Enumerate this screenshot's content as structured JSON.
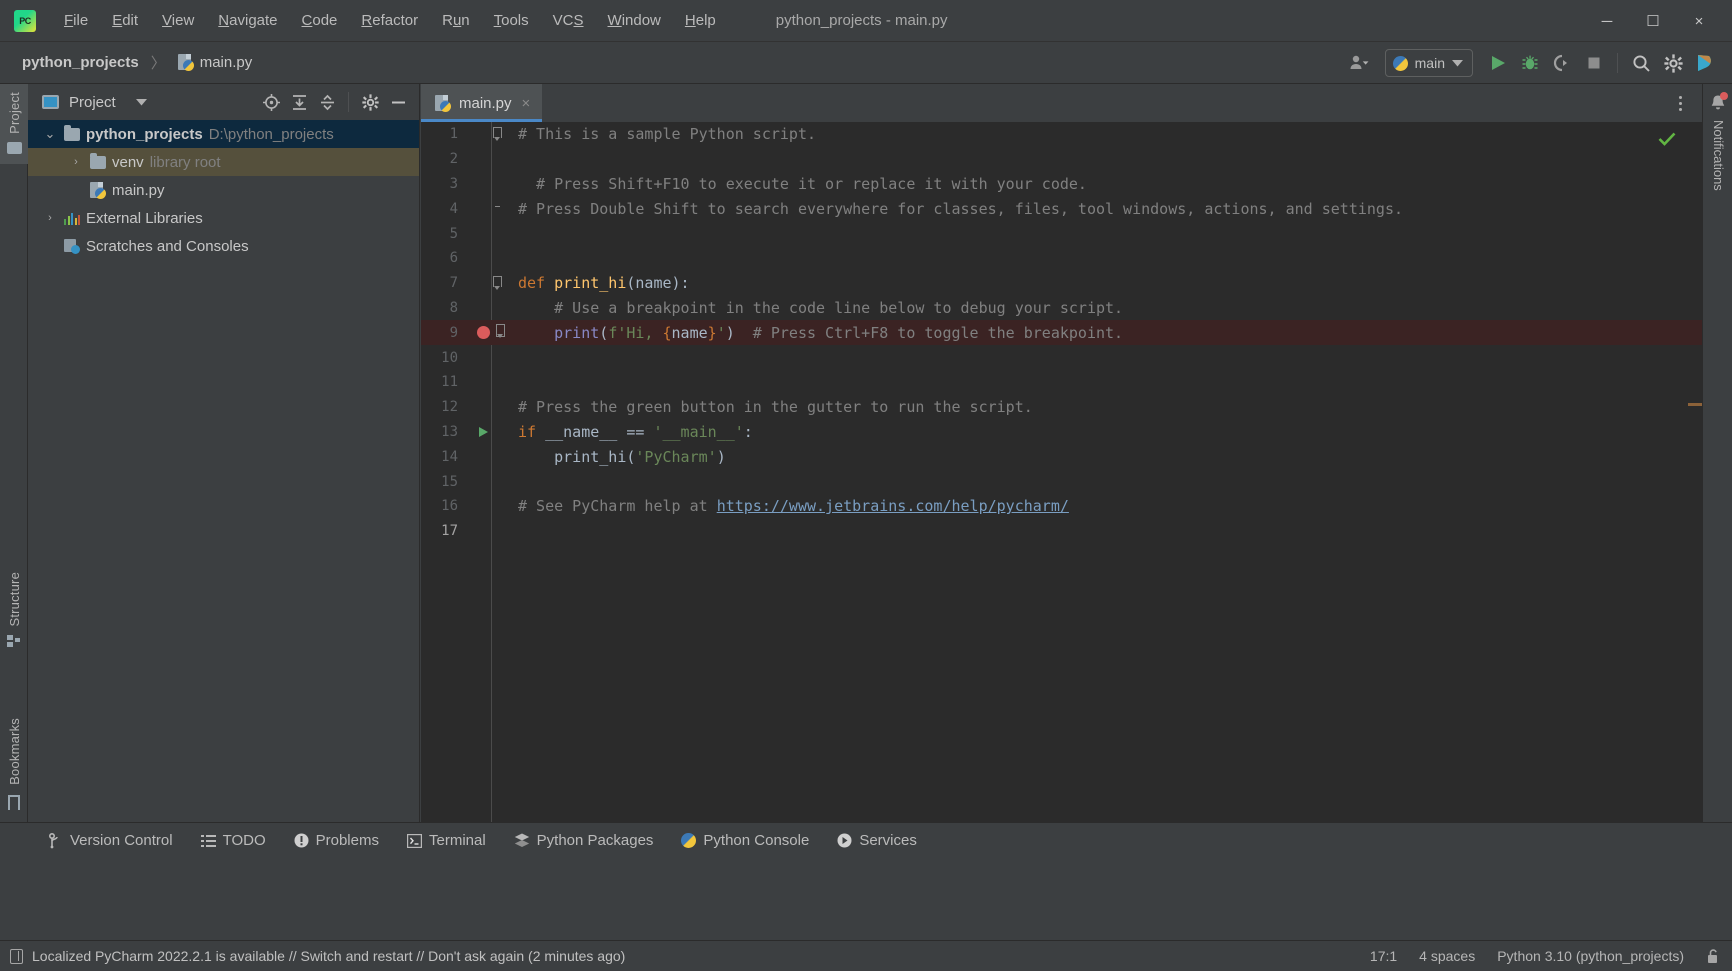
{
  "window": {
    "title": "python_projects - main.py",
    "app_icon": "pycharm-logo-icon",
    "minimize": "─",
    "maximize": "☐",
    "close": "×"
  },
  "menubar": {
    "items": [
      {
        "label": "File",
        "mnemonic": "F"
      },
      {
        "label": "Edit",
        "mnemonic": "E"
      },
      {
        "label": "View",
        "mnemonic": "V"
      },
      {
        "label": "Navigate",
        "mnemonic": "N"
      },
      {
        "label": "Code",
        "mnemonic": "C"
      },
      {
        "label": "Refactor",
        "mnemonic": "R"
      },
      {
        "label": "Run",
        "mnemonic": "u"
      },
      {
        "label": "Tools",
        "mnemonic": "T"
      },
      {
        "label": "VCS",
        "mnemonic": "S"
      },
      {
        "label": "Window",
        "mnemonic": "W"
      },
      {
        "label": "Help",
        "mnemonic": "H"
      }
    ]
  },
  "navbar": {
    "breadcrumbs": [
      {
        "label": "python_projects",
        "icon": "none"
      },
      {
        "label": "main.py",
        "icon": "python-file-icon"
      }
    ],
    "separator": "〉"
  },
  "toolbar": {
    "account_label": "account-icon",
    "run_config": {
      "label": "main",
      "icon": "python-icon",
      "chevron": "▼"
    },
    "buttons": [
      {
        "name": "run-button",
        "icon": "run-triangle-icon"
      },
      {
        "name": "debug-button",
        "icon": "bug-icon"
      },
      {
        "name": "run-with-coverage-button",
        "icon": "coverage-icon"
      },
      {
        "name": "stop-button",
        "icon": "stop-square-icon"
      },
      {
        "name": "search-everywhere-button",
        "icon": "search-icon"
      },
      {
        "name": "settings-button",
        "icon": "gear-icon"
      },
      {
        "name": "ai-assistant-button",
        "icon": "jetbrains-logo-icon"
      }
    ]
  },
  "left_rail": {
    "items": [
      {
        "label": "Project",
        "icon": "project-folder-icon",
        "active": true
      },
      {
        "label": "Structure",
        "icon": "structure-icon",
        "active": false
      },
      {
        "label": "Bookmarks",
        "icon": "bookmark-icon",
        "active": false
      }
    ]
  },
  "project_panel": {
    "title": "Project",
    "title_icon": "project-window-icon",
    "chevron": "▼",
    "header_buttons": [
      {
        "name": "select-opened-file-button",
        "icon": "crosshair-icon"
      },
      {
        "name": "expand-all-button",
        "icon": "expand-all-icon"
      },
      {
        "name": "collapse-all-button",
        "icon": "collapse-all-icon"
      },
      {
        "name": "options-button",
        "icon": "gear-icon"
      },
      {
        "name": "hide-button",
        "icon": "minimize-icon"
      }
    ],
    "tree": [
      {
        "label": "python_projects",
        "suffix": "D:\\python_projects",
        "icon": "folder-icon",
        "indent": 0,
        "arrow": "⌄",
        "expanded": true,
        "state": "selected",
        "bold": true
      },
      {
        "label": "venv",
        "suffix": "library root",
        "icon": "folder-icon",
        "indent": 1,
        "arrow": "›",
        "expanded": false,
        "state": "hover",
        "bold": false
      },
      {
        "label": "main.py",
        "suffix": "",
        "icon": "python-file-icon",
        "indent": 1,
        "arrow": "",
        "expanded": false,
        "state": "normal",
        "bold": false
      },
      {
        "label": "External Libraries",
        "suffix": "",
        "icon": "external-libraries-icon",
        "indent": 0,
        "arrow": "›",
        "expanded": false,
        "state": "normal",
        "bold": false
      },
      {
        "label": "Scratches and Consoles",
        "suffix": "",
        "icon": "scratches-icon",
        "indent": 0,
        "arrow": "",
        "expanded": false,
        "state": "normal",
        "bold": false
      }
    ]
  },
  "editor": {
    "tabs": [
      {
        "label": "main.py",
        "icon": "python-file-icon",
        "active": true,
        "close": "×"
      }
    ],
    "more_button": "editor-options-icon",
    "inspection_status": "ok-checkmark",
    "lines": [
      {
        "n": "1",
        "gutter": "fold-start",
        "tokens": [
          {
            "t": "# This is a sample Python script.",
            "c": "k-comment"
          }
        ]
      },
      {
        "n": "2",
        "gutter": "",
        "tokens": []
      },
      {
        "n": "3",
        "gutter": "",
        "tokens": [
          {
            "t": "  # Press Shift+F10 to execute it or replace it with your code.",
            "c": "k-comment"
          }
        ]
      },
      {
        "n": "4",
        "gutter": "fold-end",
        "tokens": [
          {
            "t": "# Press Double Shift to search everywhere for classes, files, tool windows, actions, and settings.",
            "c": "k-comment"
          }
        ]
      },
      {
        "n": "5",
        "gutter": "",
        "tokens": []
      },
      {
        "n": "6",
        "gutter": "",
        "tokens": []
      },
      {
        "n": "7",
        "gutter": "fold-start",
        "tokens": [
          {
            "t": "def ",
            "c": "k-kw"
          },
          {
            "t": "print_hi",
            "c": "k-fn"
          },
          {
            "t": "(name):",
            "c": "k-name"
          }
        ]
      },
      {
        "n": "8",
        "gutter": "",
        "tokens": [
          {
            "t": "    # Use a breakpoint in the code line below to debug your script.",
            "c": "k-comment"
          }
        ]
      },
      {
        "n": "9",
        "gutter": "breakpoint",
        "breakpoint": true,
        "tokens": [
          {
            "t": "    ",
            "c": "k-name"
          },
          {
            "t": "print",
            "c": "k-builtin"
          },
          {
            "t": "(",
            "c": "k-name"
          },
          {
            "t": "f'Hi, ",
            "c": "k-str"
          },
          {
            "t": "{",
            "c": "k-fstr-brace"
          },
          {
            "t": "name",
            "c": "k-name"
          },
          {
            "t": "}",
            "c": "k-fstr-brace"
          },
          {
            "t": "'",
            "c": "k-str"
          },
          {
            "t": ")",
            "c": "k-name"
          },
          {
            "t": "  # Press Ctrl+F8 to toggle the breakpoint.",
            "c": "k-comment"
          }
        ]
      },
      {
        "n": "10",
        "gutter": "",
        "tokens": []
      },
      {
        "n": "11",
        "gutter": "",
        "tokens": []
      },
      {
        "n": "12",
        "gutter": "",
        "tokens": [
          {
            "t": "# Press the green button in the gutter to run the script.",
            "c": "k-comment"
          }
        ]
      },
      {
        "n": "13",
        "gutter": "run",
        "tokens": [
          {
            "t": "if ",
            "c": "k-kw"
          },
          {
            "t": "__name__ == ",
            "c": "k-name"
          },
          {
            "t": "'__main__'",
            "c": "k-str"
          },
          {
            "t": ":",
            "c": "k-name"
          }
        ]
      },
      {
        "n": "14",
        "gutter": "",
        "tokens": [
          {
            "t": "    print_hi(",
            "c": "k-name"
          },
          {
            "t": "'PyCharm'",
            "c": "k-str"
          },
          {
            "t": ")",
            "c": "k-name"
          }
        ]
      },
      {
        "n": "15",
        "gutter": "",
        "tokens": []
      },
      {
        "n": "16",
        "gutter": "",
        "tokens": [
          {
            "t": "# See PyCharm help at ",
            "c": "k-comment"
          },
          {
            "t": "https://www.jetbrains.com/help/pycharm/",
            "c": "k-link"
          }
        ]
      },
      {
        "n": "17",
        "gutter": "",
        "current": true,
        "tokens": []
      }
    ]
  },
  "right_rail": {
    "label": "Notifications",
    "icon": "bell-icon",
    "has_badge": true
  },
  "tool_windows": {
    "items": [
      {
        "label": "Version Control",
        "icon": "branch-icon"
      },
      {
        "label": "TODO",
        "icon": "list-icon"
      },
      {
        "label": "Problems",
        "icon": "exclamation-circle-icon"
      },
      {
        "label": "Terminal",
        "icon": "terminal-icon"
      },
      {
        "label": "Python Packages",
        "icon": "packages-icon"
      },
      {
        "label": "Python Console",
        "icon": "python-icon"
      },
      {
        "label": "Services",
        "icon": "services-play-icon"
      }
    ]
  },
  "status_bar": {
    "message": "Localized PyCharm 2022.2.1 is available // Switch and restart // Don't ask again (2 minutes ago)",
    "message_icon": "ide-popup-icon",
    "caret_position": "17:1",
    "indent": "4 spaces",
    "interpreter": "Python 3.10 (python_projects)",
    "lock_icon": "unlocked-padlock-icon"
  },
  "colors": {
    "bg_chrome": "#3c3f41",
    "bg_editor": "#2b2b2b",
    "selection_blue": "#0d293e",
    "hover_olive": "#55503c",
    "tab_underline": "#4a88c7",
    "breakpoint_red": "#db5c5c",
    "breakpoint_line_bg": "#3b2323",
    "run_green": "#59a869",
    "keyword_orange": "#cc7832",
    "string_green": "#6a8759",
    "function_yellow": "#ffc66d",
    "comment_gray": "#808080",
    "text_default": "#a9b7c6"
  }
}
